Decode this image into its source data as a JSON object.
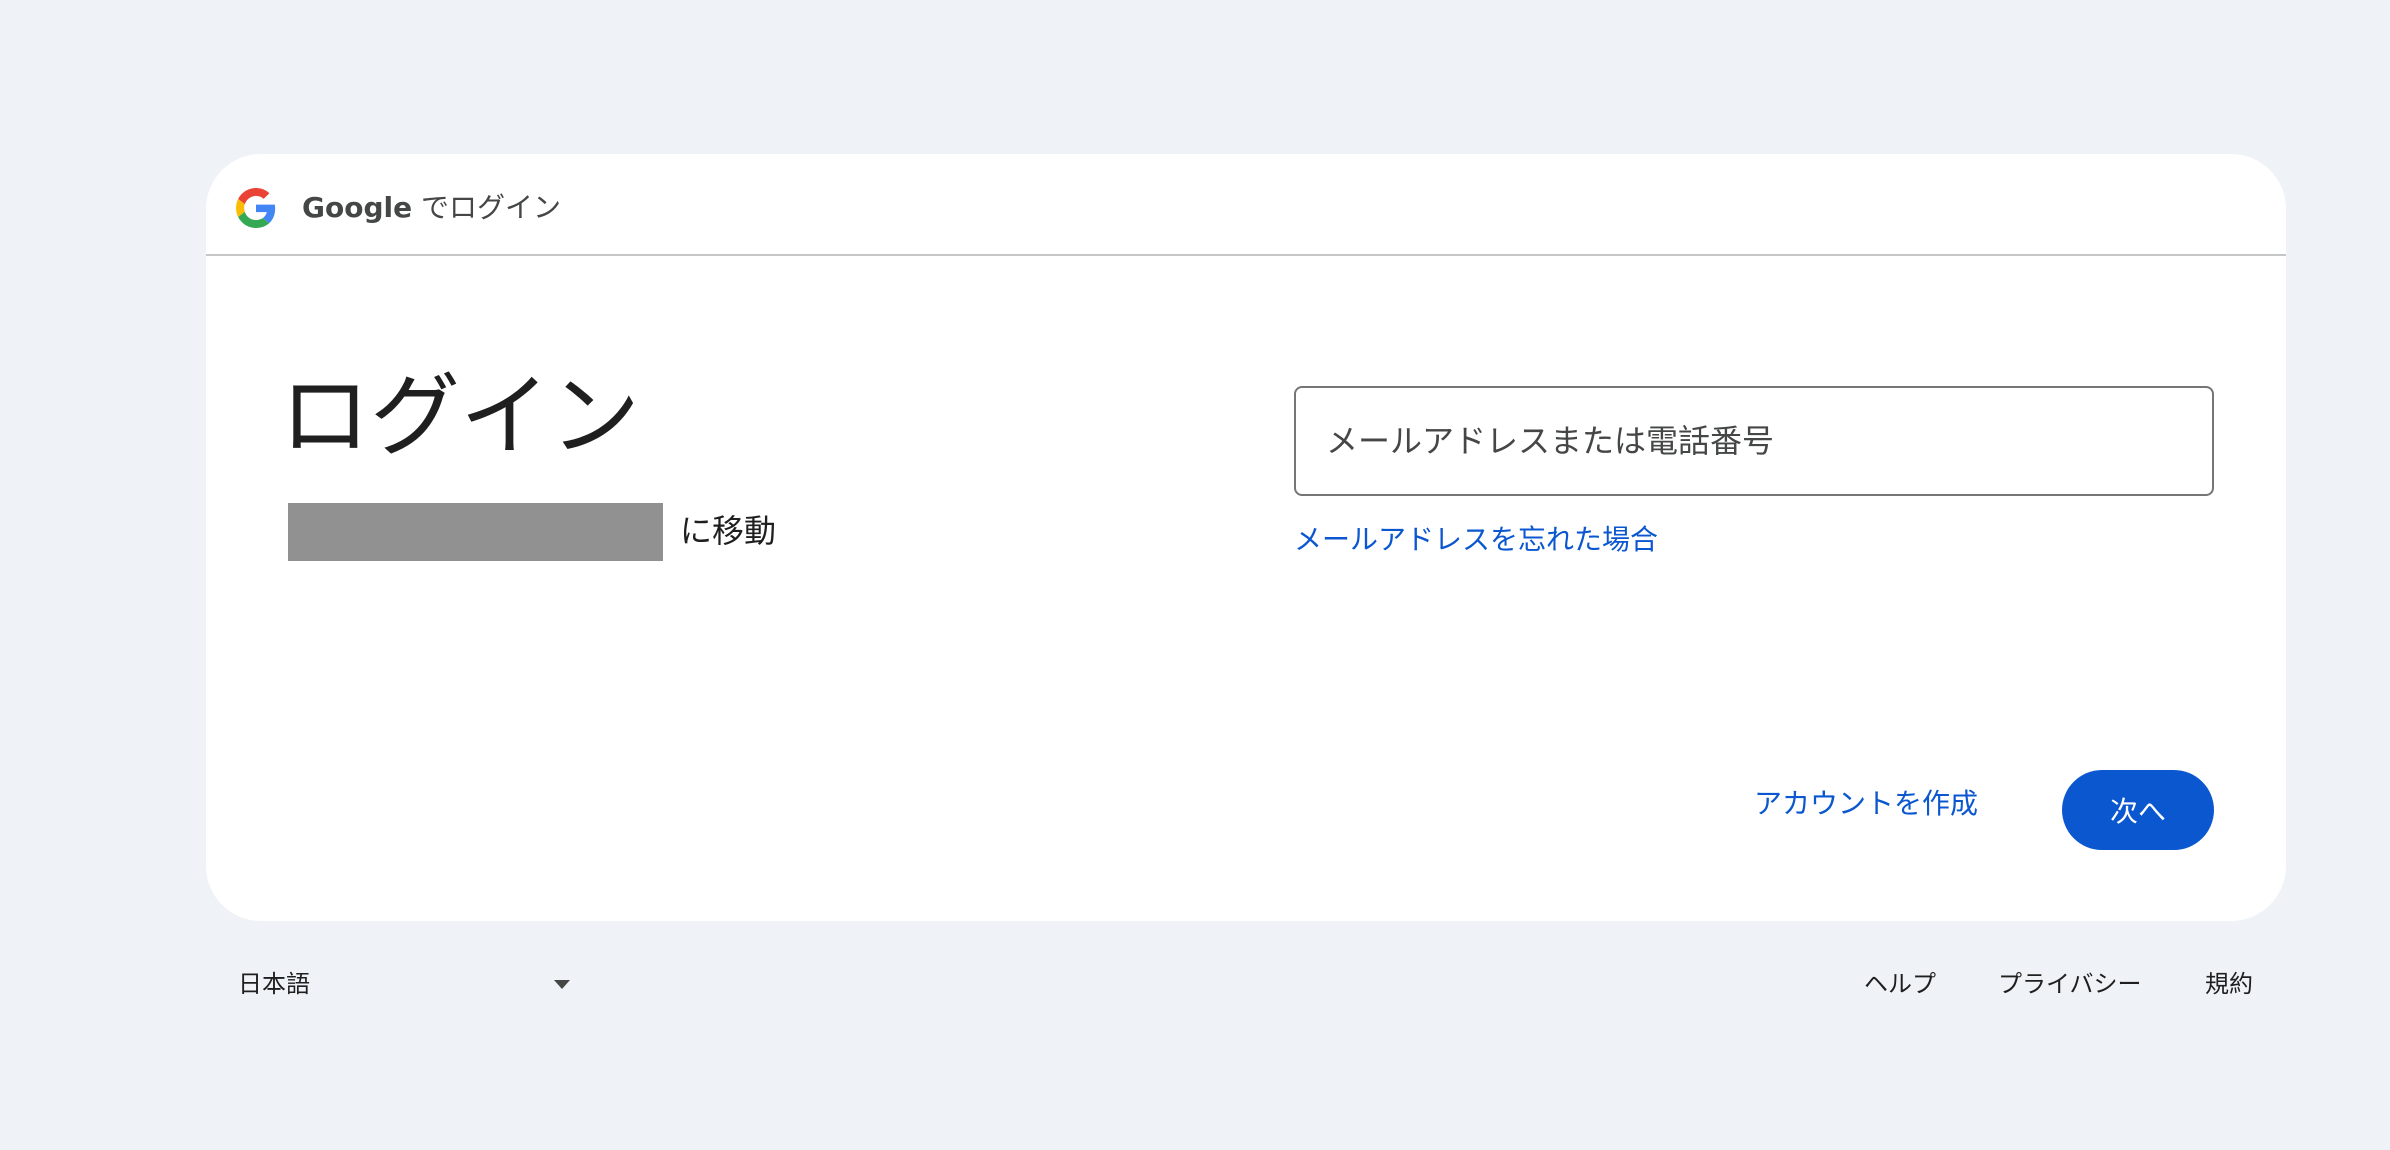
{
  "header": {
    "brand": "Google",
    "title_suffix": " でログイン",
    "logo_icon": "google-g-icon"
  },
  "main": {
    "title": "ログイン",
    "continue_suffix": "に移動"
  },
  "form": {
    "email_placeholder": "メールアドレスまたは電話番号",
    "email_value": "",
    "forgot_email_label": "メールアドレスを忘れた場合"
  },
  "actions": {
    "create_account_label": "アカウントを作成",
    "next_label": "次へ"
  },
  "footer": {
    "language": "日本語",
    "help_label": "ヘルプ",
    "privacy_label": "プライバシー",
    "terms_label": "規約"
  },
  "colors": {
    "page_background": "#eff3f7",
    "card_background": "#ffffff",
    "accent": "#0b57d0",
    "text_primary": "#1f1f1f",
    "text_secondary": "#444746",
    "redaction": "#919191"
  }
}
